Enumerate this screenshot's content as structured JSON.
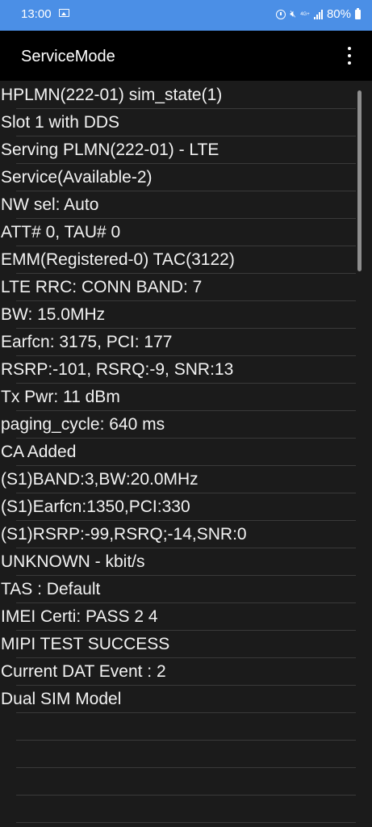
{
  "status_bar": {
    "time": "13:00",
    "icons": [
      "gallery-icon",
      "alarm-icon",
      "mute-icon",
      "4g-lte-icon",
      "signal-icon",
      "battery-icon"
    ],
    "network_label": "4G+",
    "battery": "80%"
  },
  "app_bar": {
    "title": "ServiceMode",
    "more_icon": "more-vert-icon"
  },
  "rows": [
    "HPLMN(222-01)  sim_state(1)",
    "Slot 1 with DDS",
    "Serving PLMN(222-01) - LTE",
    "Service(Available-2)",
    "NW sel: Auto",
    "ATT# 0, TAU# 0",
    "EMM(Registered-0) TAC(3122)",
    "LTE RRC: CONN BAND: 7",
    "BW: 15.0MHz",
    "Earfcn: 3175, PCI: 177",
    "RSRP:-101, RSRQ:-9, SNR:13",
    "Tx Pwr: 11 dBm",
    "paging_cycle: 640 ms",
    "CA Added",
    "(S1)BAND:3,BW:20.0MHz",
    "(S1)Earfcn:1350,PCI:330",
    "(S1)RSRP:-99,RSRQ;-14,SNR:0",
    "UNKNOWN - kbit/s",
    "TAS : Default",
    "IMEI Certi: PASS 2 4",
    "MIPI TEST SUCCESS",
    "Current DAT Event : 2",
    "Dual SIM Model",
    "",
    "",
    "",
    ""
  ],
  "colors": {
    "status_bar": "#4b8fe6",
    "app_bar": "#000000",
    "background": "#1b1b1b",
    "text": "#f2f2f2",
    "divider": "#3a3a3a"
  }
}
